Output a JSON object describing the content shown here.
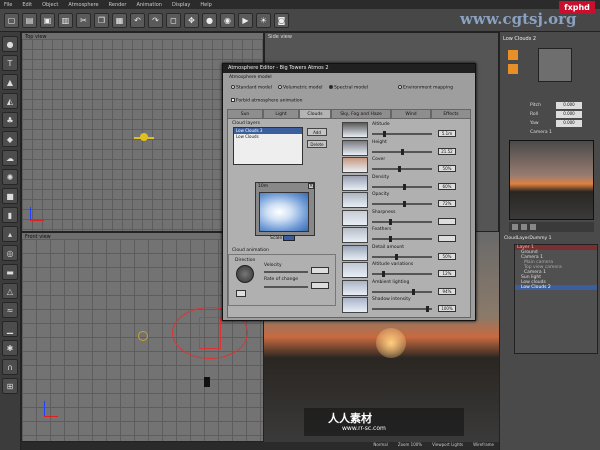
{
  "menu": [
    "File",
    "Edit",
    "Object",
    "Atmosphere",
    "Render",
    "Animation",
    "Display",
    "Help"
  ],
  "watermark_top": "www.cgtsj.org",
  "watermark_brand": "fxphd",
  "watermark_bottom_cn": "人人素材",
  "watermark_bottom_url": "www.rr-sc.com",
  "viewports": {
    "top": "Top view",
    "side": "Side view",
    "front": "Front view"
  },
  "dialog": {
    "title": "Atmosphere Editor - Big Towers Atmos 2",
    "model_label": "Atmosphere model",
    "models": [
      "Standard model",
      "Volumetric model",
      "Spectral model",
      "Environment mapping"
    ],
    "forbid_label": "Forbid atmosphere animation",
    "tabs": [
      "Sun",
      "Light",
      "Clouds",
      "Sky, Fog and Haze",
      "Wind",
      "Effects"
    ],
    "layers_label": "Cloud layers",
    "layers": [
      "Low Clouds 3",
      "Low Clouds"
    ],
    "add_btn": "Add",
    "delete_btn": "Delete",
    "preview_size": "10m",
    "scale_label": "Scale",
    "animation_label": "Cloud animation",
    "direction_label": "Direction",
    "velocity_label": "Velocity",
    "rate_label": "Rate of change",
    "params": [
      {
        "name": "Altitude",
        "value": "5.1m"
      },
      {
        "name": "Height",
        "value": "21.52"
      },
      {
        "name": "Cover",
        "value": "50%"
      },
      {
        "name": "Density",
        "value": "60%"
      },
      {
        "name": "Opacity",
        "value": "72%"
      },
      {
        "name": "Sharpness",
        "value": ""
      },
      {
        "name": "Feathers",
        "value": ""
      },
      {
        "name": "Detail amount",
        "value": "50%"
      },
      {
        "name": "Altitude variations",
        "value": "12%"
      },
      {
        "name": "Ambient lighting",
        "value": "94%"
      },
      {
        "name": "Shadow intensity",
        "value": "100%"
      }
    ]
  },
  "right_panel": {
    "title": "Low Clouds 2",
    "pitch_label": "Pitch",
    "pitch": "0.000",
    "roll_label": "Roll",
    "roll": "0.000",
    "yaw_label": "Yaw",
    "yaw": "0.000",
    "camera": "Camera 1",
    "tree_title": "CloudLayerDummy 1",
    "tree": [
      "Layer 1",
      "Ground",
      "Camera 1",
      "Main camera",
      "Top view camera",
      "Camera 1",
      "Sun light",
      "Low clouds",
      "Low Clouds 2"
    ]
  },
  "status": [
    "Normal",
    "Zoom 100%",
    "Viewport Lights",
    "Wireframe"
  ]
}
